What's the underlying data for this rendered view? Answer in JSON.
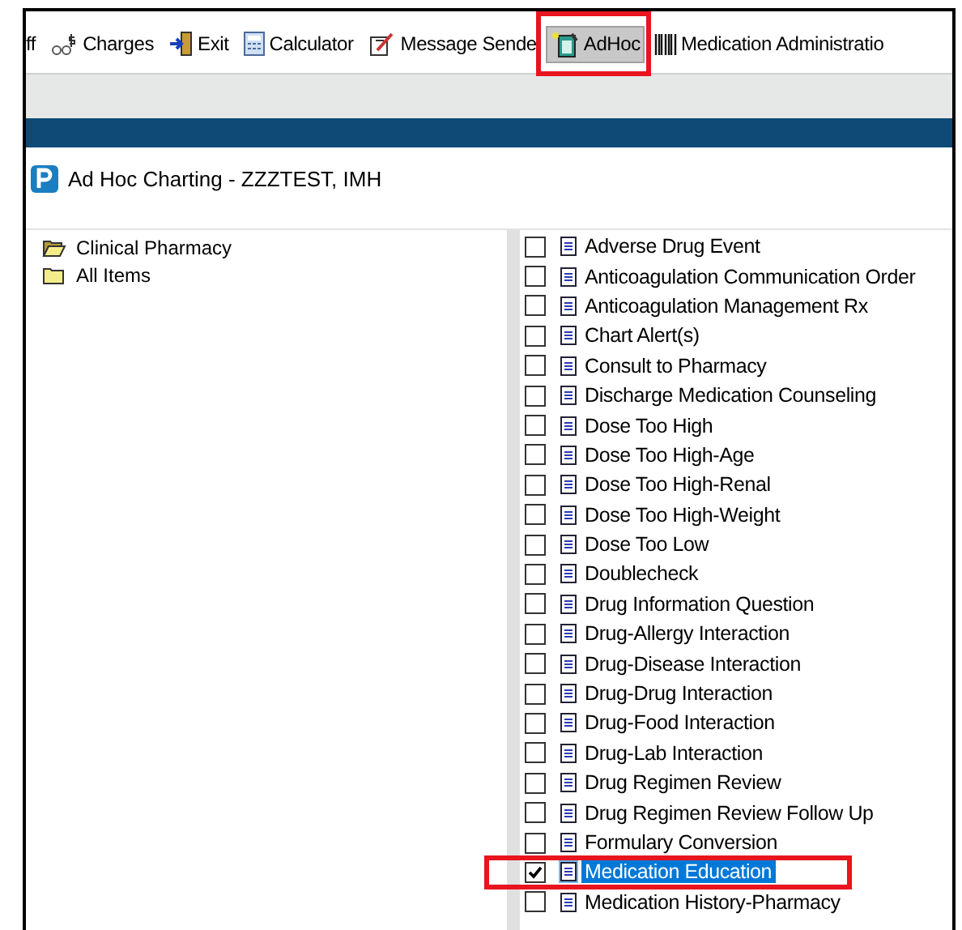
{
  "toolbar": [
    {
      "label": "ff",
      "selected": false
    },
    {
      "label": "Charges",
      "selected": false
    },
    {
      "label": "Exit",
      "selected": false
    },
    {
      "label": "Calculator",
      "selected": false
    },
    {
      "label": "Message Sende",
      "selected": false
    },
    {
      "label": "AdHoc",
      "selected": true
    },
    {
      "label": "Medication Administratio",
      "selected": false
    }
  ],
  "window": {
    "title": "Ad Hoc Charting - ZZZTEST, IMH"
  },
  "folders": [
    {
      "label": "Clinical Pharmacy",
      "expanded": true
    },
    {
      "label": "All Items",
      "expanded": false
    }
  ],
  "forms": [
    {
      "label": "Adverse Drug Event",
      "checked": false,
      "selected": false
    },
    {
      "label": "Anticoagulation Communication Order",
      "checked": false,
      "selected": false
    },
    {
      "label": "Anticoagulation Management Rx",
      "checked": false,
      "selected": false
    },
    {
      "label": "Chart Alert(s)",
      "checked": false,
      "selected": false
    },
    {
      "label": "Consult to Pharmacy",
      "checked": false,
      "selected": false
    },
    {
      "label": "Discharge Medication Counseling",
      "checked": false,
      "selected": false
    },
    {
      "label": "Dose Too High",
      "checked": false,
      "selected": false
    },
    {
      "label": "Dose Too High-Age",
      "checked": false,
      "selected": false
    },
    {
      "label": "Dose Too High-Renal",
      "checked": false,
      "selected": false
    },
    {
      "label": "Dose Too High-Weight",
      "checked": false,
      "selected": false
    },
    {
      "label": "Dose Too Low",
      "checked": false,
      "selected": false
    },
    {
      "label": "Doublecheck",
      "checked": false,
      "selected": false
    },
    {
      "label": "Drug Information Question",
      "checked": false,
      "selected": false
    },
    {
      "label": "Drug-Allergy Interaction",
      "checked": false,
      "selected": false
    },
    {
      "label": "Drug-Disease Interaction",
      "checked": false,
      "selected": false
    },
    {
      "label": "Drug-Drug Interaction",
      "checked": false,
      "selected": false
    },
    {
      "label": "Drug-Food Interaction",
      "checked": false,
      "selected": false
    },
    {
      "label": "Drug-Lab Interaction",
      "checked": false,
      "selected": false
    },
    {
      "label": "Drug Regimen Review",
      "checked": false,
      "selected": false
    },
    {
      "label": "Drug Regimen Review Follow Up",
      "checked": false,
      "selected": false
    },
    {
      "label": "Formulary Conversion",
      "checked": false,
      "selected": false
    },
    {
      "label": "Medication Education",
      "checked": true,
      "selected": true
    },
    {
      "label": "Medication History-Pharmacy",
      "checked": false,
      "selected": false
    }
  ]
}
